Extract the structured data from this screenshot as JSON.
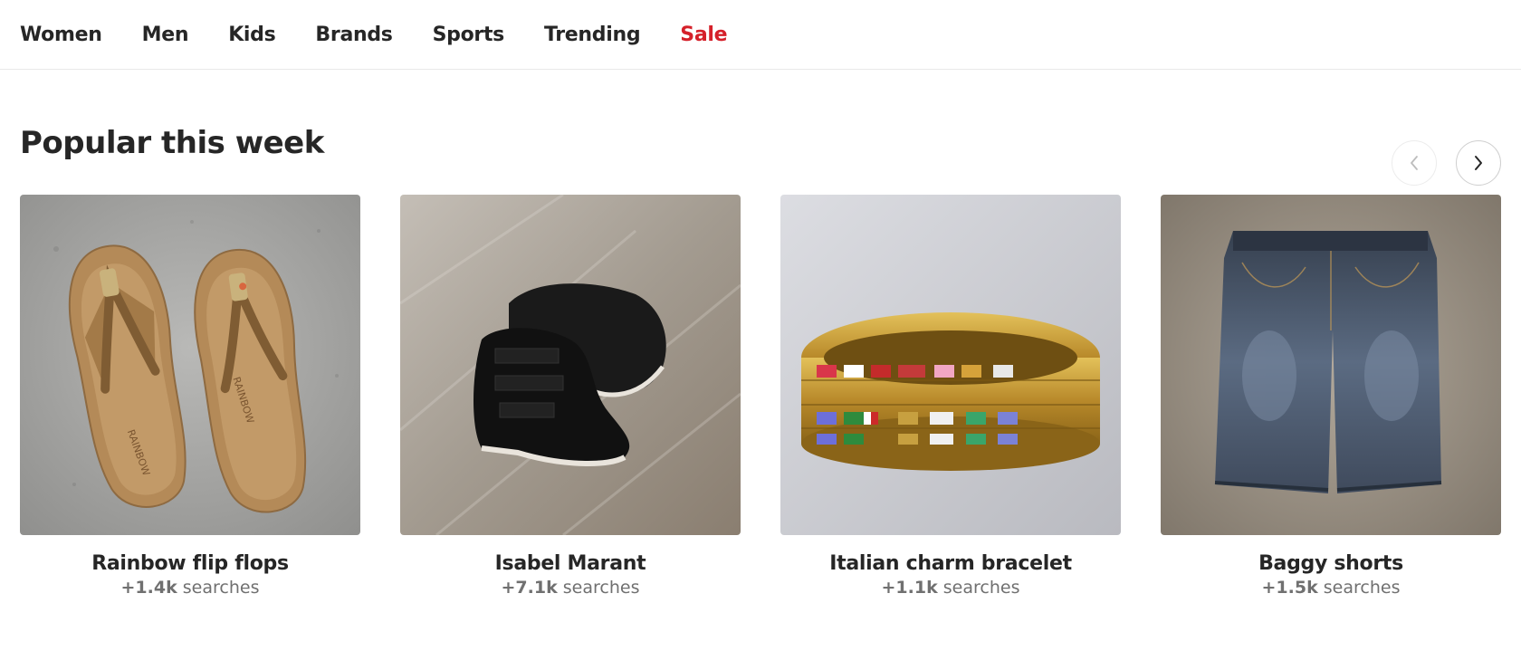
{
  "nav": {
    "items": [
      {
        "label": "Women"
      },
      {
        "label": "Men"
      },
      {
        "label": "Kids"
      },
      {
        "label": "Brands"
      },
      {
        "label": "Sports"
      },
      {
        "label": "Trending"
      },
      {
        "label": "Sale"
      }
    ],
    "sale_color": "#d5202a"
  },
  "section": {
    "title": "Popular this week",
    "prev_icon": "chevron-left-icon",
    "next_icon": "chevron-right-icon"
  },
  "cards": [
    {
      "title": "Rainbow flip flops",
      "count": "+1.4k",
      "suffix": " searches",
      "image": "flip-flops"
    },
    {
      "title": "Isabel Marant",
      "count": "+7.1k",
      "suffix": " searches",
      "image": "wedge-sneakers"
    },
    {
      "title": "Italian charm bracelet",
      "count": "+1.1k",
      "suffix": " searches",
      "image": "charm-bracelet"
    },
    {
      "title": "Baggy shorts",
      "count": "+1.5k",
      "suffix": " searches",
      "image": "denim-shorts"
    }
  ]
}
